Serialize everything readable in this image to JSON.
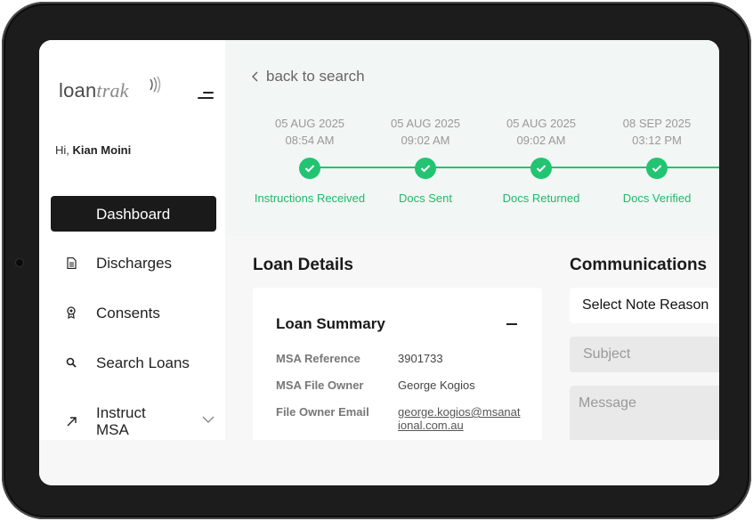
{
  "sidebar": {
    "logo_plain": "loan",
    "logo_italic": "trak",
    "greeting_prefix": "Hi,",
    "user_name": "Kian Moini",
    "items": [
      {
        "label": "Dashboard",
        "icon": "none",
        "active": true
      },
      {
        "label": "Discharges",
        "icon": "document-icon"
      },
      {
        "label": "Consents",
        "icon": "badge-icon"
      },
      {
        "label": "Search Loans",
        "icon": "search-icon"
      },
      {
        "label": "Instruct MSA",
        "icon": "arrow-up-right-icon",
        "expandable": true
      }
    ]
  },
  "main": {
    "back_label": "back to search",
    "timeline": [
      {
        "date": "05 AUG 2025",
        "time": "08:54 AM",
        "label": "Instructions Received"
      },
      {
        "date": "05 AUG 2025",
        "time": "09:02 AM",
        "label": "Docs Sent"
      },
      {
        "date": "05 AUG 2025",
        "time": "09:02 AM",
        "label": "Docs Returned"
      },
      {
        "date": "08 SEP 2025",
        "time": "03:12 PM",
        "label": "Docs Verified"
      }
    ],
    "loan_details_title": "Loan Details",
    "loan_summary": {
      "title": "Loan Summary",
      "rows": [
        {
          "label": "MSA Reference",
          "value": "3901733"
        },
        {
          "label": "MSA File Owner",
          "value": "George Kogios"
        },
        {
          "label": "File Owner Email",
          "value": "george.kogios@msanational.com.au"
        }
      ]
    },
    "communications": {
      "title": "Communications",
      "select_value": "Select Note Reason",
      "subject_placeholder": "Subject",
      "message_placeholder": "Message"
    }
  },
  "colors": {
    "accent_green": "#22c472",
    "active_nav": "#1a1a1a",
    "device_frame": "#1c1c1c"
  }
}
